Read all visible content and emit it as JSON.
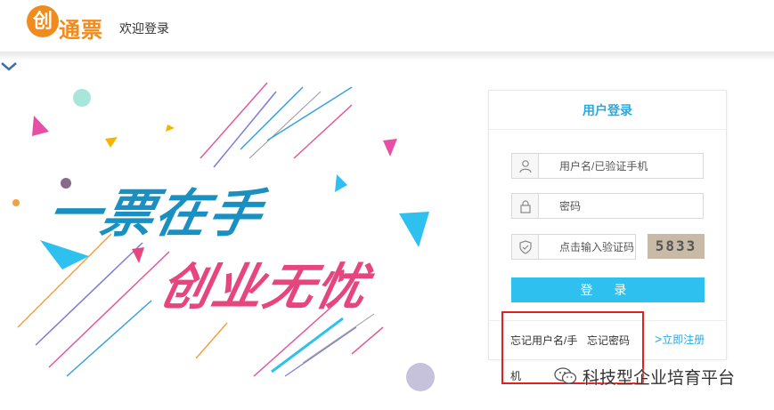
{
  "header": {
    "logo_mark": "创",
    "logo_text": "通票",
    "welcome": "欢迎登录"
  },
  "hero": {
    "slogan_line1": "一票在手",
    "slogan_line2": "创业无忧"
  },
  "login": {
    "title": "用户登录",
    "username_placeholder": "用户名/已验证手机",
    "password_placeholder": "密码",
    "captcha_placeholder": "点击输入验证码",
    "captcha_text": "5833",
    "submit_label": "登 录",
    "forgot_username_line1": "忘记用户名/手",
    "forgot_username_line2": "机",
    "forgot_password": "忘记密码",
    "register_label": "立即注册",
    "register_chevron": ">"
  },
  "watermark": {
    "text": "科技型企业培育平台"
  },
  "colors": {
    "brand_orange": "#f08c1e",
    "accent_blue": "#2ec1f0",
    "title_blue": "#2aa9e0",
    "slogan_pink": "#e7457d",
    "highlight_red": "#e22020"
  },
  "icons": {
    "username": "user-icon",
    "password": "lock-icon",
    "captcha": "shield-icon",
    "scroll": "chevron-down-icon",
    "watermark": "wechat-icon"
  }
}
